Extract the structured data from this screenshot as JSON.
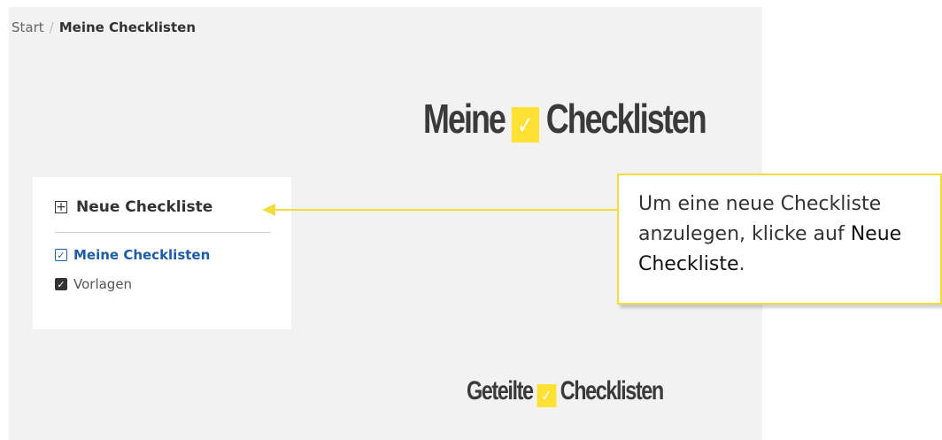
{
  "breadcrumb": {
    "start": "Start",
    "separator": "/",
    "current": "Meine Checklisten"
  },
  "hero": {
    "word1": "Meine",
    "check": "✓",
    "word2": "Checklisten"
  },
  "sidebar": {
    "new_label": "Neue Checkliste",
    "plus": "+",
    "items": [
      {
        "label": "Meine Checklisten",
        "check": "✓",
        "active": true
      },
      {
        "label": "Vorlagen",
        "check": "✓",
        "active": false
      }
    ]
  },
  "shared": {
    "word1": "Geteilte",
    "check": "✓",
    "word2": "Checklisten"
  },
  "tooltip": {
    "text_before": "Um eine neue Checkliste anzulegen, klicke auf ",
    "highlight": "Neue Checkliste",
    "text_after": "."
  },
  "colors": {
    "accent_yellow": "#ffe033",
    "link_blue": "#1e5ba8",
    "background": "#f2f2f2"
  }
}
